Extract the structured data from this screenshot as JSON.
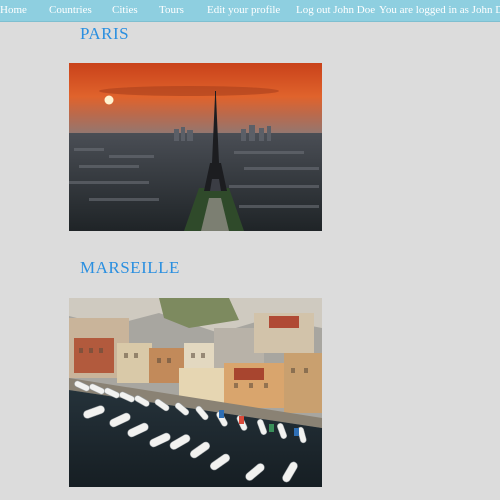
{
  "nav": {
    "home": "Home",
    "countries": "Countries",
    "cities": "Cities",
    "tours": "Tours",
    "edit_profile": "Edit your profile",
    "logout": "Log out John Doe",
    "logged_in": "You are logged in as John Doe"
  },
  "cities": [
    {
      "name": "PARIS",
      "photo": "paris-eiffel-tower-sunset-photo"
    },
    {
      "name": "MARSEILLE",
      "photo": "marseille-harbor-boats-photo"
    }
  ],
  "colors": {
    "nav_bg": "#8ecfe0",
    "title": "#2a8fe0",
    "page_bg": "#dcdcdc"
  }
}
